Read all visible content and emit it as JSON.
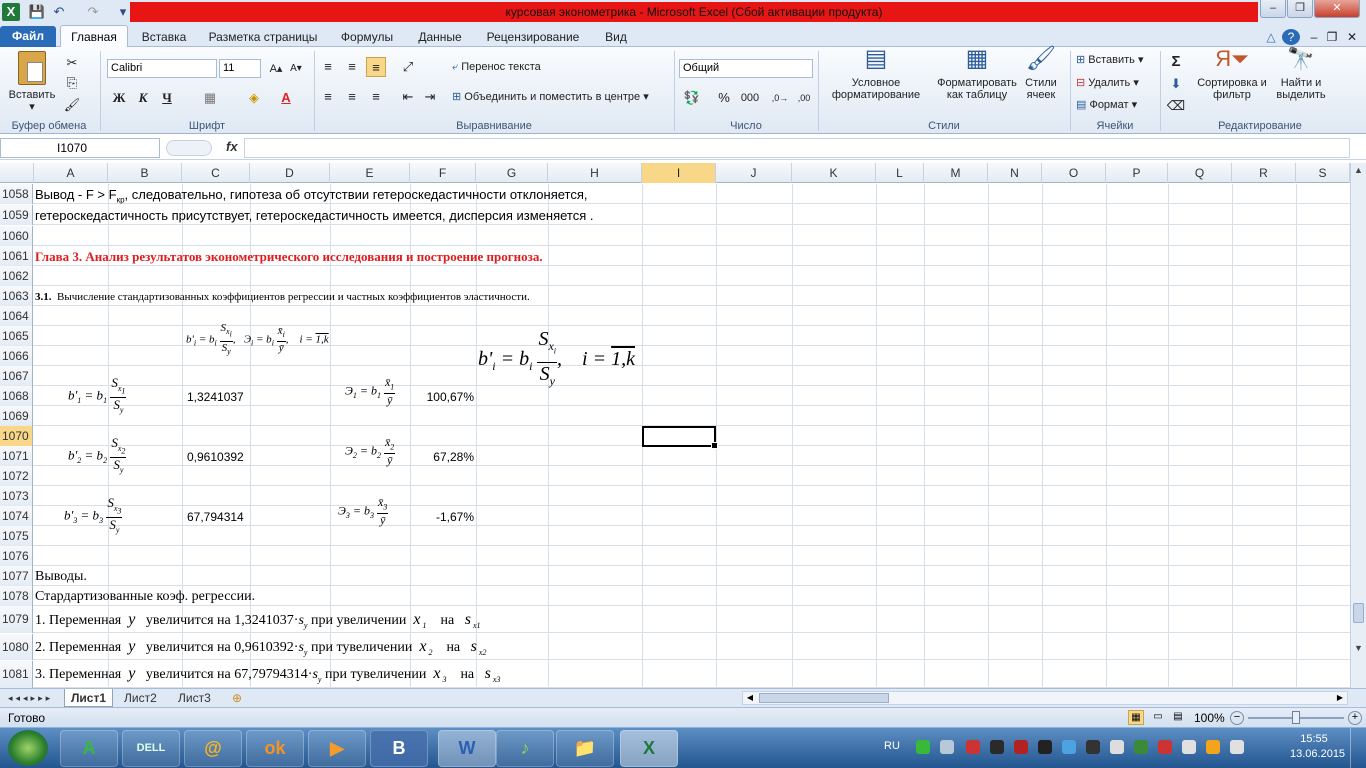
{
  "window": {
    "title": "курсовая эконометрика  -  Microsoft Excel (Сбой активации продукта)",
    "min_label": "–",
    "max_label": "❐",
    "close_label": "✕",
    "doc_min": "–",
    "doc_restore": "❐",
    "doc_close": "✕"
  },
  "quick_access": {
    "excel_icon": "X",
    "save_icon": "💾",
    "undo_icon": "↶",
    "redo_icon": "↷",
    "customize_icon": "▾"
  },
  "tabs": [
    "Файл",
    "Главная",
    "Вставка",
    "Разметка страницы",
    "Формулы",
    "Данные",
    "Рецензирование",
    "Вид"
  ],
  "ribbon": {
    "clipboard": {
      "paste": "Вставить",
      "label": "Буфер обмена"
    },
    "font": {
      "name": "Calibri",
      "size": "11",
      "bold": "Ж",
      "italic": "К",
      "underline": "Ч",
      "label": "Шрифт"
    },
    "alignment": {
      "wrap": "Перенос текста",
      "merge": "Объединить и поместить в центре",
      "label": "Выравнивание"
    },
    "number": {
      "format": "Общий",
      "percent": "%",
      "thousands": "000",
      "label": "Число"
    },
    "styles": {
      "conditional": "Условное форматирование",
      "table": "Форматировать как таблицу",
      "cell": "Стили ячеек",
      "label": "Стили"
    },
    "cells": {
      "insert": "Вставить",
      "delete": "Удалить",
      "format": "Формат",
      "label": "Ячейки"
    },
    "editing": {
      "sum": "Σ",
      "sort": "Сортировка и фильтр",
      "find": "Найти и выделить",
      "label": "Редактирование"
    }
  },
  "formula_bar": {
    "name_box": "I1070",
    "fx": "fx",
    "formula": ""
  },
  "columns": [
    "A",
    "B",
    "C",
    "D",
    "E",
    "F",
    "G",
    "H",
    "I",
    "J",
    "K",
    "L",
    "M",
    "N",
    "O",
    "P",
    "Q",
    "R",
    "S"
  ],
  "selected_column": "I",
  "rows": [
    "1058",
    "1059",
    "1060",
    "1061",
    "1062",
    "1063",
    "1064",
    "1065",
    "1066",
    "1067",
    "1068",
    "1069",
    "1070",
    "1071",
    "1072",
    "1073",
    "1074",
    "1075",
    "1076",
    "1077",
    "1078",
    "1079",
    "1080",
    "1081"
  ],
  "selected_row": "1070",
  "cells": {
    "r1058": {
      "prefix": "Вывод -  F > F",
      "sub": "кр",
      "rest": ", следовательно, гипотеза об отсутствии гетероскедастичности отклоняется,"
    },
    "r1059": "гетероскедастичность присутствует, гетероскедастичность имеется, дисперсия изменяется .",
    "r1061": "Глава 3. Анализ результатов эконометрического исследования и построение прогноза.",
    "r1063_num": "3.1.",
    "r1063": "Вычисление стандартизованных коэффициентов  регрессии и частных коэффициентов эластичности.",
    "c1068": "1,3241037",
    "f1068": "100,67%",
    "c1071": "0,9610392",
    "f1071": "67,28%",
    "c1074": "67,794314",
    "f1074": "-1,67%",
    "r1077": "Выводы.",
    "r1078": "Стардартизованные коэф.  регрессии.",
    "r1079": {
      "lead": "1.  Переменная",
      "mid": "увеличится на  1,3241037·",
      "after": "при увеличении",
      "on": "на"
    },
    "r1080": {
      "lead": "2.  Переменная",
      "mid": "увеличится на  0,9610392·",
      "after": "при тувеличении",
      "on": "на"
    },
    "r1081": {
      "lead": "3.  Переменная",
      "mid": "увеличится на  67,79794314·",
      "after": "при тувеличении",
      "on": "на"
    }
  },
  "sheets": [
    "Лист1",
    "Лист2",
    "Лист3"
  ],
  "active_sheet": "Лист1",
  "status": {
    "ready": "Готово",
    "zoom": "100%"
  },
  "taskbar": {
    "lang": "RU",
    "time": "15:55",
    "date": "13.06.2015",
    "apps": [
      "A",
      "DELL",
      "@",
      "ok",
      "▶",
      "B",
      "W",
      "♪",
      "📁",
      "X"
    ]
  }
}
